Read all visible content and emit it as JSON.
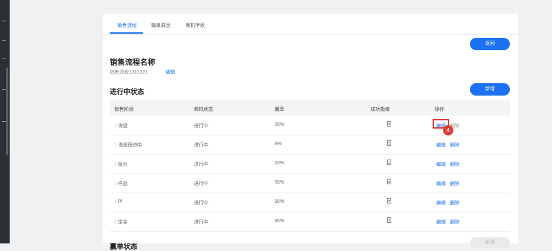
{
  "tabs": [
    {
      "label": "销售流程"
    },
    {
      "label": "输单原因"
    },
    {
      "label": "商机字段"
    }
  ],
  "return_button": "返回",
  "process": {
    "title": "销售流程名称",
    "name": "销售流程1312321",
    "edit_label": "编辑"
  },
  "in_progress": {
    "title": "进行中状态",
    "add_button": "新增",
    "columns": [
      "销售阶段",
      "商机状态",
      "赢率",
      "成功指南",
      "操作"
    ],
    "rows": [
      {
        "stage": "询盘",
        "status": "进行中",
        "rate": "20%",
        "edit": "编辑",
        "delete": "删除"
      },
      {
        "stage": "询盘跟进中",
        "status": "进行中",
        "rate": "8%",
        "edit": "编辑",
        "delete": "删除"
      },
      {
        "stage": "报价",
        "status": "进行中",
        "rate": "10%",
        "edit": "编辑",
        "delete": "删除"
      },
      {
        "stage": "样品",
        "status": "进行中",
        "rate": "50%",
        "edit": "编辑",
        "delete": "删除"
      },
      {
        "stage": "PI",
        "status": "进行中",
        "rate": "90%",
        "edit": "编辑",
        "delete": "删除"
      },
      {
        "stage": "定金",
        "status": "进行中",
        "rate": "95%",
        "edit": "编辑",
        "delete": "删除"
      }
    ]
  },
  "win_section": {
    "title": "赢单状态",
    "add_button": "新增"
  },
  "annotation": {
    "step_number": "4"
  },
  "colors": {
    "accent": "#1d72f3",
    "annotation": "#e53935"
  }
}
